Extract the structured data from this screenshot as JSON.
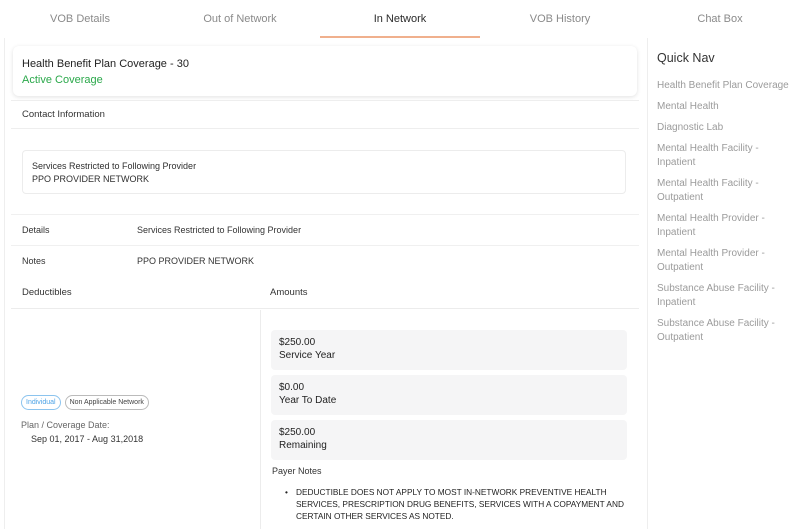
{
  "tabs": [
    {
      "label": "VOB Details"
    },
    {
      "label": "Out of Network"
    },
    {
      "label": "In Network"
    },
    {
      "label": "VOB History"
    },
    {
      "label": "Chat Box"
    }
  ],
  "active_tab_index": 2,
  "plan": {
    "title": "Health Benefit Plan Coverage - 30",
    "status": "Active Coverage",
    "status_color": "#2aa84a"
  },
  "contact": {
    "label": "Contact Information"
  },
  "provider_box": {
    "line1": "Services Restricted to Following Provider",
    "line2": "PPO PROVIDER NETWORK"
  },
  "details_row": {
    "label": "Details",
    "value": "Services Restricted to Following Provider"
  },
  "notes_row": {
    "label": "Notes",
    "value": "PPO PROVIDER NETWORK"
  },
  "deductibles": {
    "col1": "Deductibles",
    "col2": "Amounts",
    "badges": [
      "Individual",
      "Non Applicable Network"
    ],
    "plan_date_label": "Plan / Coverage Date:",
    "plan_date": "Sep 01, 2017 - Aug 31,2018",
    "amounts": [
      {
        "value": "$250.00",
        "label": "Service Year"
      },
      {
        "value": "$0.00",
        "label": "Year To Date"
      },
      {
        "value": "$250.00",
        "label": "Remaining"
      }
    ],
    "payer_notes_title": "Payer Notes",
    "payer_notes": [
      "DEDUCTIBLE DOES NOT APPLY TO MOST IN-NETWORK PREVENTIVE HEALTH SERVICES, PRESCRIPTION DRUG BENEFITS, SERVICES WITH A COPAYMENT AND CERTAIN OTHER SERVICES AS NOTED."
    ]
  },
  "quick_nav": {
    "title": "Quick Nav",
    "items": [
      "Health Benefit Plan Coverage",
      "Mental Health",
      "Diagnostic Lab",
      "Mental Health Facility - Inpatient",
      "Mental Health Facility - Outpatient",
      "Mental Health Provider - Inpatient",
      "Mental Health Provider - Outpatient",
      "Substance Abuse Facility - Inpatient",
      "Substance Abuse Facility - Outpatient"
    ]
  },
  "colors": {
    "accent_tab_underline": "#f0b08d",
    "badge_blue": "#4da3e6",
    "muted_text": "#9b9b9b"
  }
}
